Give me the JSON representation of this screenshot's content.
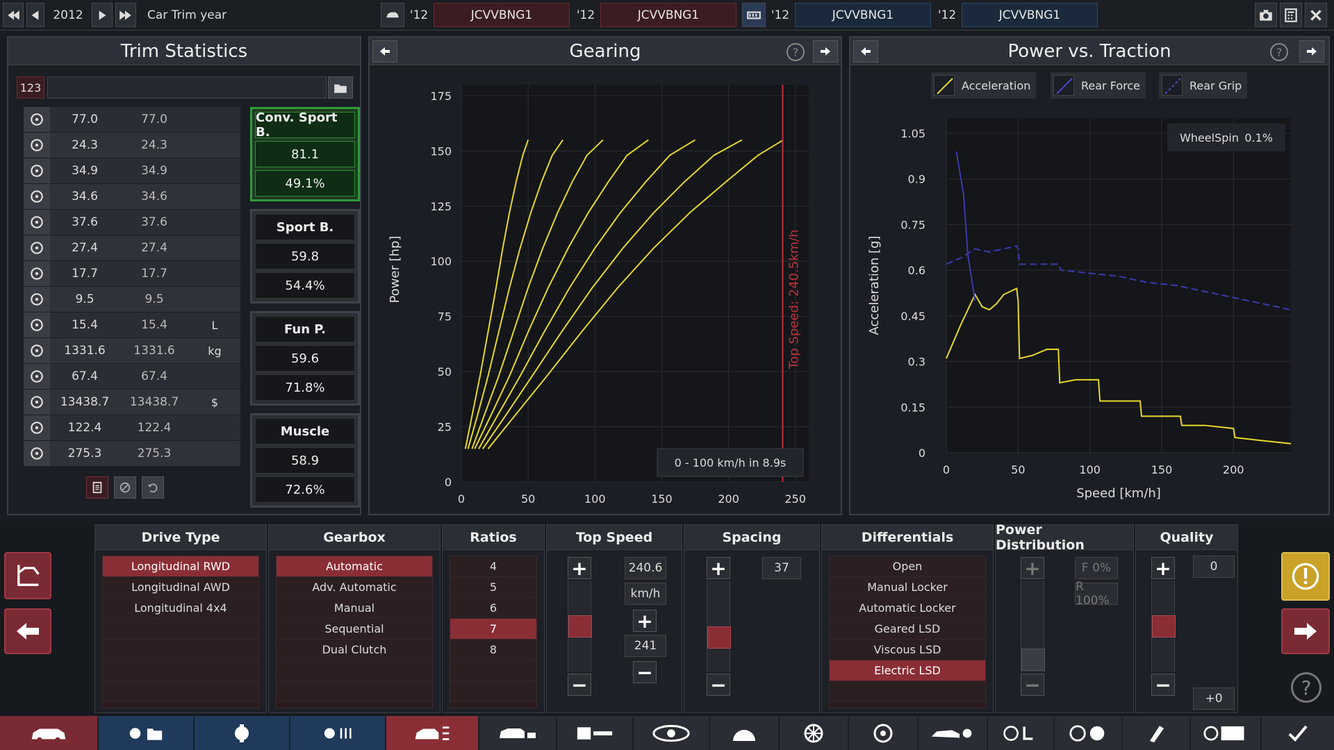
{
  "topbar": {
    "year": "2012",
    "label": "Car Trim year",
    "tabs": [
      {
        "year": "'12",
        "name": "JCVVBNG1"
      },
      {
        "year": "'12",
        "name": "JCVVBNG1"
      },
      {
        "year": "'12",
        "name": "JCVVBNG1"
      },
      {
        "year": "'12",
        "name": "JCVVBNG1"
      }
    ]
  },
  "trim": {
    "title": "Trim Statistics",
    "id_label": "123",
    "rows": [
      {
        "icon": "steering-wheel-icon",
        "v1": "77.0",
        "v2": "77.0",
        "unit": ""
      },
      {
        "icon": "checkered-flag-icon",
        "v1": "24.3",
        "v2": "24.3",
        "unit": ""
      },
      {
        "icon": "seat-icon",
        "v1": "34.9",
        "v2": "34.9",
        "unit": ""
      },
      {
        "icon": "diamond-icon",
        "v1": "34.6",
        "v2": "34.6",
        "unit": ""
      },
      {
        "icon": "safety-icon",
        "v1": "37.6",
        "v2": "37.6",
        "unit": ""
      },
      {
        "icon": "passengers-icon",
        "v1": "27.4",
        "v2": "27.4",
        "unit": ""
      },
      {
        "icon": "cargo-car-icon",
        "v1": "17.7",
        "v2": "17.7",
        "unit": ""
      },
      {
        "icon": "offroad-car-icon",
        "v1": "9.5",
        "v2": "9.5",
        "unit": ""
      },
      {
        "icon": "fuel-icon",
        "v1": "15.4",
        "v2": "15.4",
        "unit": "L"
      },
      {
        "icon": "weight-icon",
        "v1": "1331.6",
        "v2": "1331.6",
        "unit": "kg"
      },
      {
        "icon": "emissions-icon",
        "v1": "67.4",
        "v2": "67.4",
        "unit": ""
      },
      {
        "icon": "cost-icon",
        "v1": "13438.7",
        "v2": "13438.7",
        "unit": "$"
      },
      {
        "icon": "service-icon",
        "v1": "122.4",
        "v2": "122.4",
        "unit": ""
      },
      {
        "icon": "engineering-icon",
        "v1": "275.3",
        "v2": "275.3",
        "unit": ""
      }
    ],
    "categories": [
      {
        "name": "Conv. Sport B.",
        "score": "81.1",
        "pct": "49.1%"
      },
      {
        "name": "Sport B.",
        "score": "59.8",
        "pct": "54.4%"
      },
      {
        "name": "Fun P.",
        "score": "59.6",
        "pct": "71.8%"
      },
      {
        "name": "Muscle",
        "score": "58.9",
        "pct": "72.6%"
      }
    ]
  },
  "gearing": {
    "title": "Gearing",
    "top_speed_label": "Top Speed: 240.5km/h",
    "accel_label": "0 - 100 km/h in 8.9s"
  },
  "traction": {
    "title": "Power vs. Traction",
    "legend": [
      "Acceleration",
      "Rear Force",
      "Rear Grip"
    ],
    "wheelspin_label": "WheelSpin",
    "wheelspin_value": "0.1%"
  },
  "chart_data": [
    {
      "type": "line",
      "xlabel": "Speed [km/h]",
      "ylabel": "Power [hp]",
      "xlim": [
        0,
        260
      ],
      "ylim": [
        0,
        180
      ],
      "xticks": [
        "0",
        "50",
        "100",
        "150",
        "200",
        "250"
      ],
      "yticks": [
        "0",
        "25",
        "50",
        "75",
        "100",
        "125",
        "150",
        "175"
      ],
      "series": [
        {
          "x": [
            3,
            8,
            14,
            20,
            26,
            31,
            36,
            41,
            46,
            50
          ],
          "values": [
            15,
            30,
            48,
            68,
            88,
            106,
            122,
            136,
            148,
            155
          ]
        },
        {
          "x": [
            5,
            12,
            20,
            28,
            36,
            44,
            52,
            60,
            68,
            76
          ],
          "values": [
            15,
            30,
            48,
            68,
            88,
            106,
            122,
            136,
            148,
            155
          ]
        },
        {
          "x": [
            8,
            17,
            28,
            39,
            50,
            61,
            72,
            83,
            94,
            106
          ],
          "values": [
            15,
            30,
            48,
            68,
            88,
            106,
            122,
            136,
            148,
            155
          ]
        },
        {
          "x": [
            10,
            22,
            36,
            50,
            65,
            80,
            95,
            110,
            124,
            140
          ],
          "values": [
            15,
            30,
            48,
            68,
            88,
            106,
            122,
            136,
            148,
            155
          ]
        },
        {
          "x": [
            13,
            27,
            44,
            62,
            81,
            100,
            119,
            138,
            156,
            175
          ],
          "values": [
            15,
            30,
            48,
            68,
            88,
            106,
            122,
            136,
            148,
            155
          ]
        },
        {
          "x": [
            16,
            33,
            53,
            75,
            98,
            121,
            144,
            167,
            189,
            210
          ],
          "values": [
            15,
            30,
            48,
            68,
            88,
            106,
            122,
            136,
            148,
            155
          ]
        },
        {
          "x": [
            20,
            40,
            64,
            90,
            117,
            144,
            171,
            198,
            222,
            241
          ],
          "values": [
            15,
            30,
            48,
            68,
            88,
            106,
            122,
            136,
            148,
            155
          ]
        }
      ],
      "topspeed": 240.5
    },
    {
      "type": "line",
      "xlabel": "Speed [km/h]",
      "ylabel": "Acceleration [g]",
      "xlim": [
        0,
        240
      ],
      "ylim": [
        0,
        1.1
      ],
      "xticks": [
        "0",
        "50",
        "100",
        "150",
        "200"
      ],
      "yticks": [
        "0",
        "0.15",
        "0.3",
        "0.45",
        "0.6",
        "0.75",
        "0.9",
        "1.05"
      ],
      "series": [
        {
          "name": "Acceleration",
          "color": "#e8d82a",
          "x": [
            0,
            10,
            20,
            25,
            30,
            35,
            40,
            49,
            50,
            51,
            60,
            70,
            78,
            79,
            90,
            106,
            107,
            120,
            135,
            136,
            150,
            163,
            164,
            180,
            200,
            201,
            220,
            240
          ],
          "values": [
            0.31,
            0.42,
            0.52,
            0.48,
            0.47,
            0.49,
            0.52,
            0.54,
            0.5,
            0.31,
            0.32,
            0.34,
            0.34,
            0.23,
            0.24,
            0.24,
            0.17,
            0.17,
            0.17,
            0.12,
            0.12,
            0.12,
            0.09,
            0.09,
            0.08,
            0.05,
            0.04,
            0.03
          ]
        },
        {
          "name": "Rear Force",
          "color": "#3a3ab0",
          "x": [
            7,
            12,
            15,
            20
          ],
          "values": [
            0.99,
            0.85,
            0.65,
            0.5
          ]
        },
        {
          "name": "Rear Grip",
          "color": "#3a3ab0",
          "dashed": true,
          "x": [
            0,
            10,
            20,
            30,
            40,
            49,
            50,
            51,
            60,
            70,
            78,
            80,
            100,
            120,
            140,
            160,
            180,
            200,
            220,
            240
          ],
          "values": [
            0.62,
            0.64,
            0.67,
            0.66,
            0.67,
            0.68,
            0.67,
            0.62,
            0.62,
            0.62,
            0.62,
            0.6,
            0.59,
            0.58,
            0.56,
            0.55,
            0.53,
            0.51,
            0.49,
            0.47
          ]
        }
      ]
    }
  ],
  "bottom": {
    "drive_type": {
      "title": "Drive Type",
      "options": [
        "Longitudinal RWD",
        "Longitudinal AWD",
        "Longitudinal 4x4"
      ],
      "selected": 0
    },
    "gearbox": {
      "title": "Gearbox",
      "options": [
        "Automatic",
        "Adv. Automatic",
        "Manual",
        "Sequential",
        "Dual Clutch"
      ],
      "selected": 0
    },
    "ratios": {
      "title": "Ratios",
      "options": [
        "4",
        "5",
        "6",
        "7",
        "8"
      ],
      "selected": 3
    },
    "top_speed": {
      "title": "Top Speed",
      "value": "240.6",
      "unit": "km/h",
      "target": "241",
      "slider": 0.45
    },
    "spacing": {
      "title": "Spacing",
      "value": "37",
      "slider": 0.55
    },
    "differentials": {
      "title": "Differentials",
      "options": [
        "Open",
        "Manual Locker",
        "Automatic Locker",
        "Geared LSD",
        "Viscous LSD",
        "Electric LSD"
      ],
      "selected": 5
    },
    "power_distribution": {
      "title": "Power Distribution",
      "front": "F 0%",
      "rear": "R 100%",
      "slider": 1.0
    },
    "quality": {
      "title": "Quality",
      "value": "0",
      "delta": "+0",
      "slider": 0.5
    }
  },
  "colors": {
    "accent_red": "#8a2e36",
    "accent_green": "#2f9a38",
    "yellow": "#e8d82a",
    "blue": "#3a3ab0",
    "warning": "#c9a227"
  }
}
